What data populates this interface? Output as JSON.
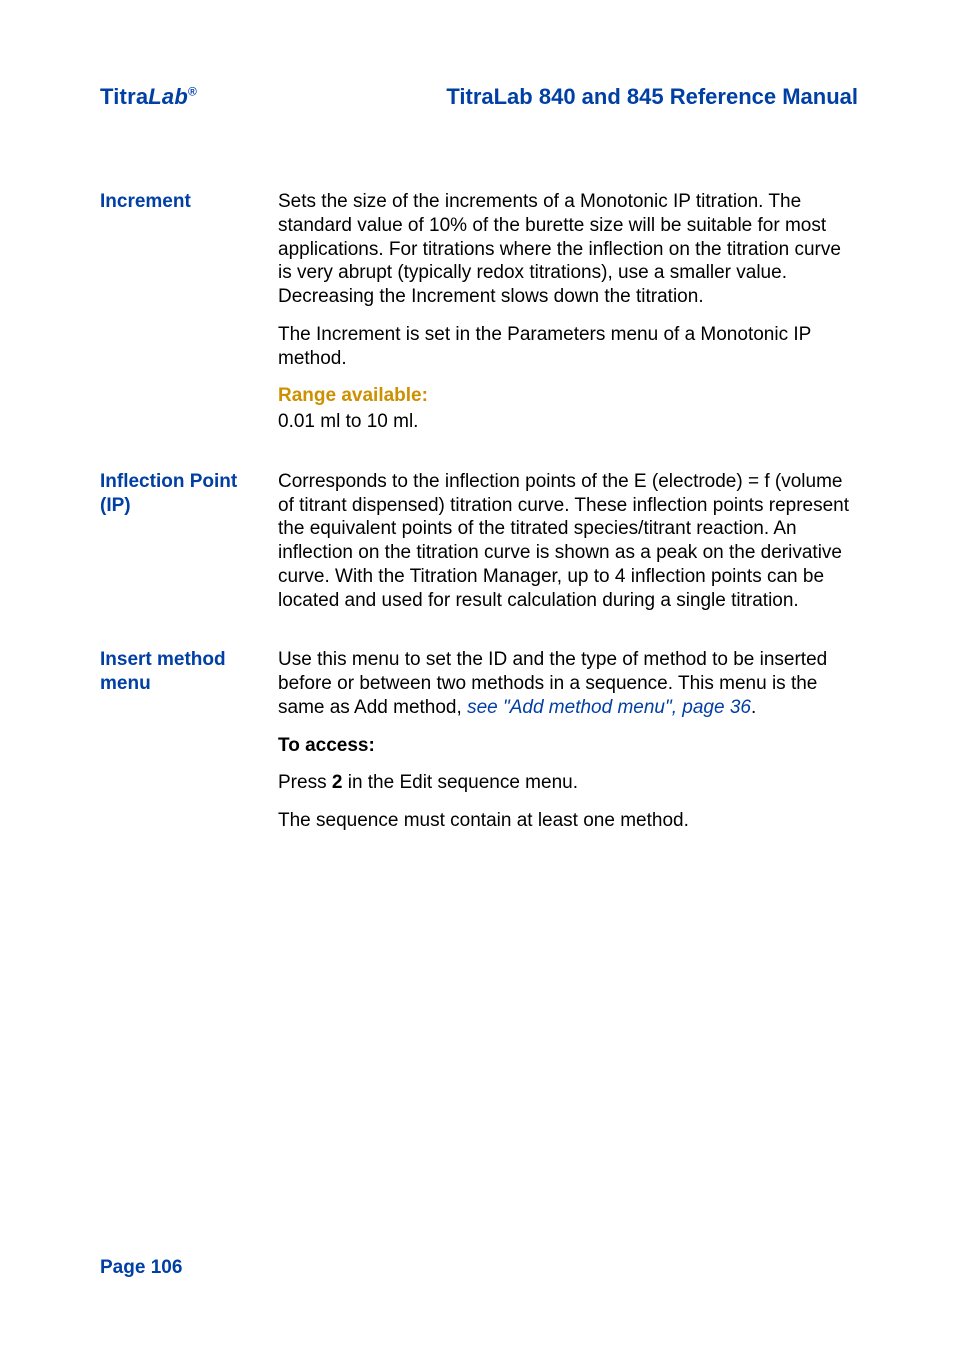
{
  "header": {
    "brand_prefix": "Titra",
    "brand_lab": "Lab",
    "brand_reg": "®",
    "title": "TitraLab 840 and 845 Reference Manual"
  },
  "entries": {
    "increment": {
      "term": "Increment",
      "p1": "Sets the size of the increments of a Monotonic IP titration. The standard value of 10% of the burette size will be suitable for most applications. For titrations where the inflection on the titration curve is very abrupt (typically redox titrations), use a smaller value. Decreasing the Increment slows down the titration.",
      "p2": "The Increment is set in the Parameters menu of a Monotonic IP method.",
      "range_label": "Range available:",
      "range_value": "0.01 ml to 10 ml."
    },
    "inflection": {
      "term": "Inflection Point (IP)",
      "p1": "Corresponds to the inflection points of the E (electrode) = f (volume of titrant dispensed) titration curve. These inflection points represent the equivalent points of the titrated species/titrant reaction. An inflection on the titration curve is shown as a peak on the derivative curve. With the Titration Manager, up to 4 inflection points can be located and used for result calculation during a single titration."
    },
    "insert": {
      "term": "Insert method menu",
      "p1_pre": "Use this menu to set the ID and the type of method to be inserted before or between two methods in a sequence. This menu is the same as Add method, ",
      "p1_link": "see \"Add method menu\", page 36",
      "p1_post": ".",
      "access_label": "To access:",
      "access_pre": "Press ",
      "access_key": "2",
      "access_post": " in the Edit sequence menu.",
      "note": "The sequence must contain at least one method."
    }
  },
  "footer": {
    "page_label": "Page 106"
  }
}
